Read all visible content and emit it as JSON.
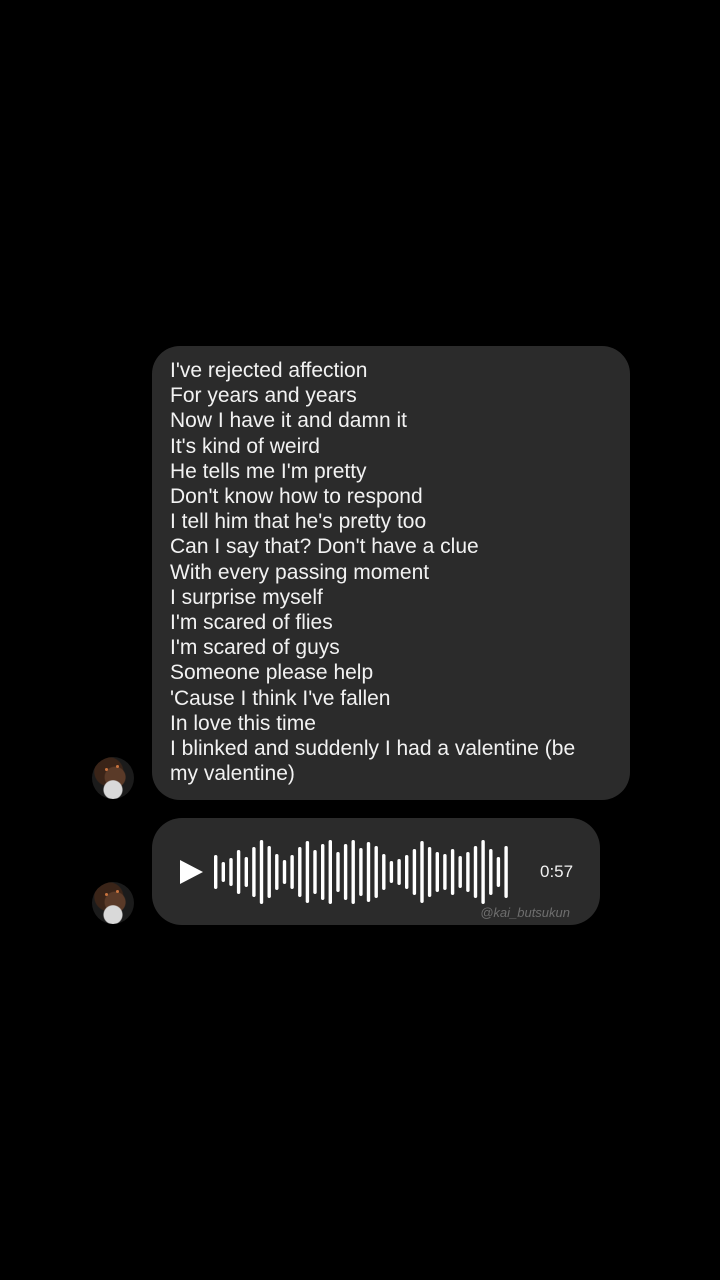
{
  "conversation": {
    "lyrics_message": {
      "lines": [
        "I've rejected affection",
        "For years and years",
        "Now I have it and damn it",
        "It's kind of weird",
        "He tells me I'm pretty",
        "Don't know how to respond",
        "I tell him that he's pretty too",
        "Can I say that? Don't have a clue",
        "With every passing moment",
        "I surprise myself",
        "I'm scared of flies",
        "I'm scared of guys",
        "Someone please help",
        "'Cause I think I've fallen",
        "In love this time",
        "I blinked and suddenly I had a valentine (be my valentine)"
      ]
    },
    "voice_message": {
      "duration": "0:57",
      "watermark": "@kai_butsukun",
      "play_icon": "play-icon"
    }
  },
  "colors": {
    "background": "#000000",
    "bubble": "#2b2b2b",
    "text": "#f2f2f2",
    "watermark": "#6e6e6e"
  }
}
